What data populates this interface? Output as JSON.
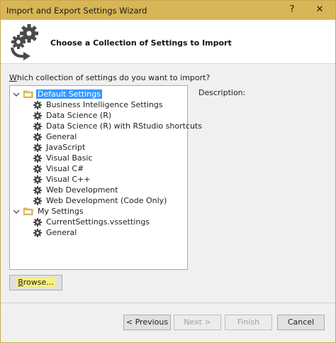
{
  "window": {
    "title": "Import and Export Settings Wizard",
    "help_glyph": "?",
    "close_glyph": "✕"
  },
  "header": {
    "title": "Choose a Collection of Settings to Import",
    "icon": "gears-arrow-icon"
  },
  "prompt": {
    "access_key": "W",
    "rest": "hich collection of settings do you want to import?"
  },
  "tree": {
    "groups": [
      {
        "label": "Default Settings",
        "selected": true,
        "expanded": true,
        "items": [
          "Business Intelligence Settings",
          "Data Science (R)",
          "Data Science (R) with RStudio shortcuts",
          "General",
          "JavaScript",
          "Visual Basic",
          "Visual C#",
          "Visual C++",
          "Web Development",
          "Web Development (Code Only)"
        ]
      },
      {
        "label": "My Settings",
        "selected": false,
        "expanded": true,
        "items": [
          "CurrentSettings.vssettings",
          "General"
        ]
      }
    ]
  },
  "description": {
    "label": "Description:"
  },
  "buttons": {
    "browse_key": "B",
    "browse_rest": "rowse...",
    "previous": "< Previous",
    "next": "Next >",
    "finish": "Finish",
    "cancel": "Cancel"
  },
  "colors": {
    "titlebar": "#d6b656",
    "selection": "#3399ff",
    "highlight": "#f6f27a"
  }
}
